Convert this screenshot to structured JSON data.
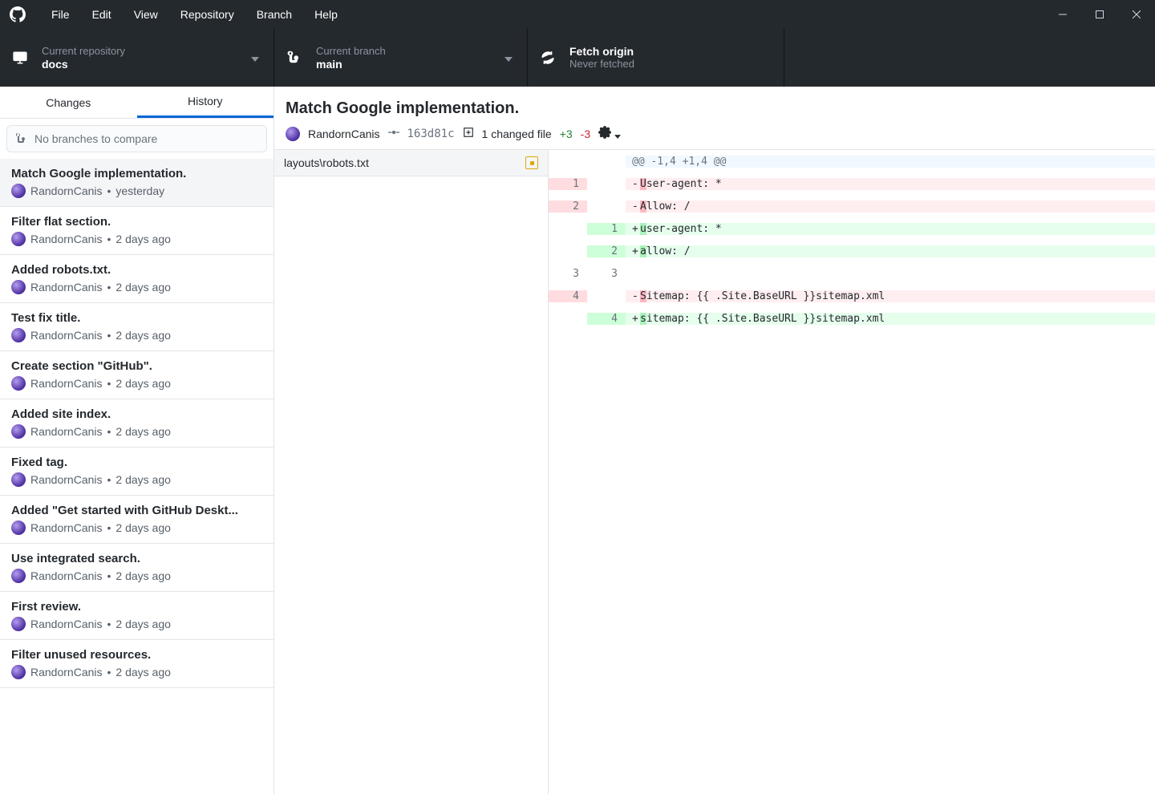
{
  "menu": {
    "items": [
      "File",
      "Edit",
      "View",
      "Repository",
      "Branch",
      "Help"
    ]
  },
  "toolbar": {
    "repo": {
      "label": "Current repository",
      "value": "docs"
    },
    "branch": {
      "label": "Current branch",
      "value": "main"
    },
    "fetch": {
      "label": "Fetch origin",
      "value": "Never fetched"
    }
  },
  "tabs": {
    "changes": "Changes",
    "history": "History"
  },
  "branch_compare_placeholder": "No branches to compare",
  "commits": [
    {
      "title": "Match Google implementation.",
      "author": "RandornCanis",
      "time": "yesterday"
    },
    {
      "title": "Filter flat section.",
      "author": "RandornCanis",
      "time": "2 days ago"
    },
    {
      "title": "Added robots.txt.",
      "author": "RandornCanis",
      "time": "2 days ago"
    },
    {
      "title": "Test fix title.",
      "author": "RandornCanis",
      "time": "2 days ago"
    },
    {
      "title": "Create section \"GitHub\".",
      "author": "RandornCanis",
      "time": "2 days ago"
    },
    {
      "title": "Added site index.",
      "author": "RandornCanis",
      "time": "2 days ago"
    },
    {
      "title": "Fixed tag.",
      "author": "RandornCanis",
      "time": "2 days ago"
    },
    {
      "title": "Added \"Get started with GitHub Deskt...",
      "author": "RandornCanis",
      "time": "2 days ago"
    },
    {
      "title": "Use integrated search.",
      "author": "RandornCanis",
      "time": "2 days ago"
    },
    {
      "title": "First review.",
      "author": "RandornCanis",
      "time": "2 days ago"
    },
    {
      "title": "Filter unused resources.",
      "author": "RandornCanis",
      "time": "2 days ago"
    }
  ],
  "commit_detail": {
    "title": "Match Google implementation.",
    "author": "RandornCanis",
    "sha": "163d81c",
    "files_changed": "1 changed file",
    "additions": "+3",
    "deletions": "-3",
    "file": "layouts\\robots.txt",
    "diff": [
      {
        "type": "hunk",
        "old": "",
        "new": "",
        "text": "@@ -1,4 +1,4 @@"
      },
      {
        "type": "del",
        "old": "1",
        "new": "",
        "prefix": "-",
        "hl": "U",
        "rest": "ser-agent: *"
      },
      {
        "type": "del",
        "old": "2",
        "new": "",
        "prefix": "-",
        "hl": "A",
        "rest": "llow: /"
      },
      {
        "type": "add",
        "old": "",
        "new": "1",
        "prefix": "+",
        "hl": "u",
        "rest": "ser-agent: *"
      },
      {
        "type": "add",
        "old": "",
        "new": "2",
        "prefix": "+",
        "hl": "a",
        "rest": "llow: /"
      },
      {
        "type": "ctx",
        "old": "3",
        "new": "3",
        "text": ""
      },
      {
        "type": "del",
        "old": "4",
        "new": "",
        "prefix": "-",
        "hl": "S",
        "rest": "itemap: {{ .Site.BaseURL }}sitemap.xml"
      },
      {
        "type": "add",
        "old": "",
        "new": "4",
        "prefix": "+",
        "hl": "s",
        "rest": "itemap: {{ .Site.BaseURL }}sitemap.xml"
      }
    ]
  }
}
